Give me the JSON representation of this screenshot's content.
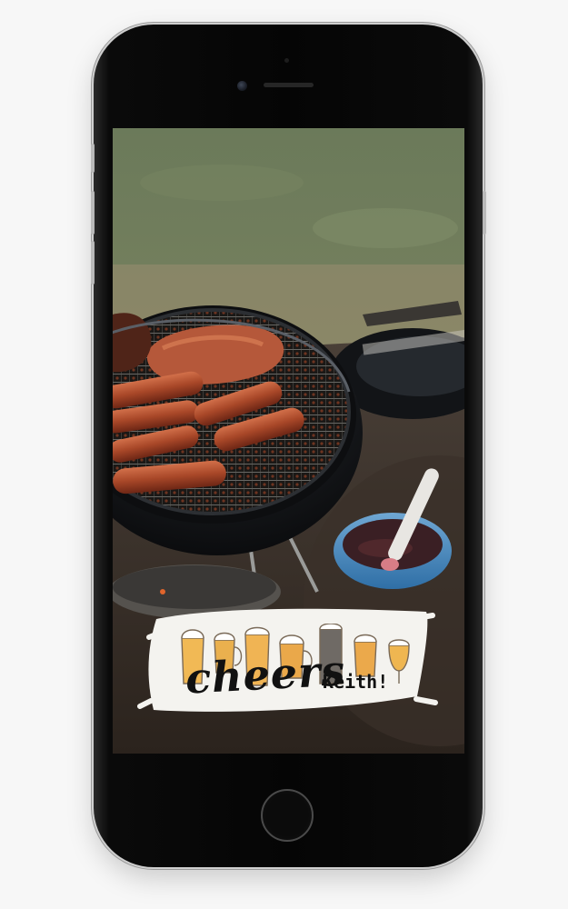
{
  "device": {
    "model": "smartphone"
  },
  "story": {
    "photo_subject": "barbecue-grill",
    "sticker": {
      "word": "cheers",
      "name": "Keith!",
      "glasses": [
        "pilsner",
        "mug",
        "stein",
        "mug",
        "tall-glass",
        "mug",
        "goblet"
      ],
      "beer_color": "#e8a94a"
    }
  }
}
